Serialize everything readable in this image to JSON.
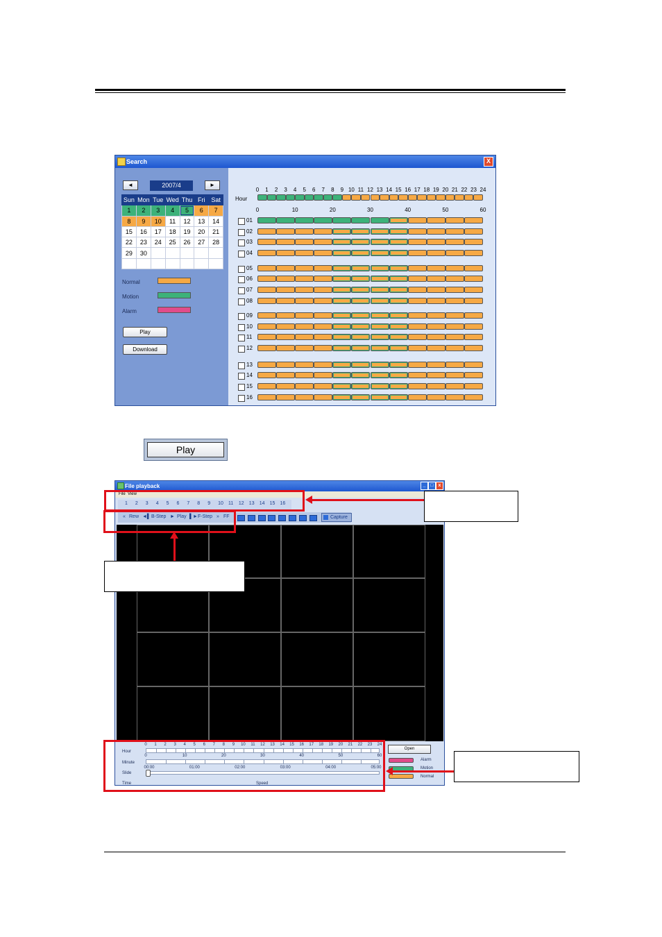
{
  "search_window": {
    "title": "Search",
    "close_label": "X",
    "month": "2007/4",
    "prev_label": "◄",
    "next_label": "►",
    "weekdays": [
      "Sun",
      "Mon",
      "Tue",
      "Wed",
      "Thu",
      "Fri",
      "Sat"
    ],
    "weeks": [
      [
        "1",
        "2",
        "3",
        "4",
        "5",
        "6",
        "7"
      ],
      [
        "8",
        "9",
        "10",
        "11",
        "12",
        "13",
        "14"
      ],
      [
        "15",
        "16",
        "17",
        "18",
        "19",
        "20",
        "21"
      ],
      [
        "22",
        "23",
        "24",
        "25",
        "26",
        "27",
        "28"
      ],
      [
        "29",
        "30",
        "",
        "",
        "",
        "",
        ""
      ],
      [
        "",
        "",
        "",
        "",
        "",
        "",
        ""
      ]
    ],
    "legend": {
      "normal": "Normal",
      "motion": "Motion",
      "alarm": "Alarm"
    },
    "colors": {
      "normal": "#f6a945",
      "motion": "#3db27a",
      "alarm": "#e24c8a"
    },
    "play_label": "Play",
    "download_label": "Download",
    "hour_label": "Hour",
    "hours": [
      "0",
      "1",
      "2",
      "3",
      "4",
      "5",
      "6",
      "7",
      "8",
      "9",
      "10",
      "11",
      "12",
      "13",
      "14",
      "15",
      "16",
      "17",
      "18",
      "19",
      "20",
      "21",
      "22",
      "23",
      "24"
    ],
    "minutes": [
      "0",
      "10",
      "20",
      "30",
      "40",
      "50",
      "60"
    ],
    "channels": [
      "01",
      "02",
      "03",
      "04",
      "05",
      "06",
      "07",
      "08",
      "09",
      "10",
      "11",
      "12",
      "13",
      "14",
      "15",
      "16"
    ]
  },
  "play_button_label": "Play",
  "file_playback": {
    "title": "File playback",
    "menu": {
      "file": "File",
      "view": "View"
    },
    "channel_numbers": [
      "1",
      "2",
      "3",
      "4",
      "5",
      "6",
      "7",
      "8",
      "9",
      "10",
      "11",
      "12",
      "13",
      "14",
      "15",
      "16"
    ],
    "controls": {
      "rew": "Rew",
      "bstep": "B-Step",
      "play": "Play",
      "fstep": "F-Step",
      "ff": "FF",
      "capture": "Capture"
    },
    "timeline": {
      "hour_label": "Hour",
      "minute_label": "Minute",
      "slide_label": "Slide",
      "time_label": "Time",
      "speed_label": "Speed",
      "hours": [
        "0",
        "1",
        "2",
        "3",
        "4",
        "5",
        "6",
        "7",
        "8",
        "9",
        "10",
        "11",
        "12",
        "13",
        "14",
        "15",
        "16",
        "17",
        "18",
        "19",
        "20",
        "21",
        "22",
        "23",
        "24"
      ],
      "minutes": [
        "0",
        "10",
        "20",
        "30",
        "40",
        "50",
        "60"
      ],
      "slide_times": [
        "00:00",
        "01:00",
        "02:00",
        "03:00",
        "04:00",
        "05:00"
      ]
    },
    "open_label": "Open",
    "legend": {
      "alarm": "Alarm",
      "motion": "Motion",
      "normal": "Normal"
    }
  }
}
